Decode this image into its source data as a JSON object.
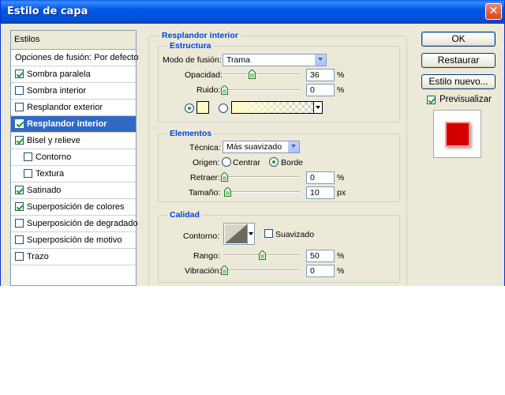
{
  "window": {
    "title": "Estilo de capa",
    "close_glyph": "✕"
  },
  "left_panel": {
    "header": "Estilos",
    "items": [
      {
        "label": "Opciones de fusión: Por defecto",
        "checkbox": null,
        "selected": false,
        "sub": false
      },
      {
        "label": "Sombra paralela",
        "checkbox": true,
        "selected": false,
        "sub": false
      },
      {
        "label": "Sombra interior",
        "checkbox": false,
        "selected": false,
        "sub": false
      },
      {
        "label": "Resplandor exterior",
        "checkbox": false,
        "selected": false,
        "sub": false
      },
      {
        "label": "Resplandor interior",
        "checkbox": true,
        "selected": true,
        "sub": false
      },
      {
        "label": "Bisel y relieve",
        "checkbox": true,
        "selected": false,
        "sub": false
      },
      {
        "label": "Contorno",
        "checkbox": false,
        "selected": false,
        "sub": true
      },
      {
        "label": "Textura",
        "checkbox": false,
        "selected": false,
        "sub": true
      },
      {
        "label": "Satinado",
        "checkbox": true,
        "selected": false,
        "sub": false
      },
      {
        "label": "Superposición de colores",
        "checkbox": true,
        "selected": false,
        "sub": false
      },
      {
        "label": "Superposición de degradado",
        "checkbox": false,
        "selected": false,
        "sub": false
      },
      {
        "label": "Superposición de motivo",
        "checkbox": false,
        "selected": false,
        "sub": false
      },
      {
        "label": "Trazo",
        "checkbox": false,
        "selected": false,
        "sub": false
      }
    ]
  },
  "main": {
    "section_title": "Resplandor interior",
    "estructura": {
      "title": "Estructura",
      "blend_mode_label": "Modo de fusión:",
      "blend_mode_value": "Trama",
      "opacity_label": "Opacidad:",
      "opacity_value": "36",
      "opacity_unit": "%",
      "opacity_level": 0.36,
      "noise_label": "Ruido:",
      "noise_value": "0",
      "noise_unit": "%",
      "noise_level": 0,
      "color_swatch": "#fffcc8",
      "gradient_from": "#fffcc8"
    },
    "elementos": {
      "title": "Elementos",
      "technique_label": "Técnica:",
      "technique_value": "Más suavizado",
      "origin_label": "Origen:",
      "origin_center": "Centrar",
      "origin_edge": "Borde",
      "origin_selected": "edge",
      "choke_label": "Retraer:",
      "choke_value": "0",
      "choke_unit": "%",
      "choke_level": 0,
      "size_label": "Tamaño:",
      "size_value": "10",
      "size_unit": "px",
      "size_level": 0.04
    },
    "calidad": {
      "title": "Calidad",
      "contour_label": "Contorno:",
      "antialiased_label": "Suavizado",
      "antialiased": false,
      "range_label": "Rango:",
      "range_value": "50",
      "range_unit": "%",
      "range_level": 0.5,
      "jitter_label": "Vibración:",
      "jitter_value": "0",
      "jitter_unit": "%",
      "jitter_level": 0
    }
  },
  "buttons": {
    "ok": "OK",
    "reset": "Restaurar",
    "new_style": "Estilo nuevo...",
    "preview_label": "Previsualizar",
    "preview_checked": true
  },
  "colors": {
    "accent": "#316ac5",
    "group_title": "#0046d5",
    "preview_red": "#d40000"
  }
}
